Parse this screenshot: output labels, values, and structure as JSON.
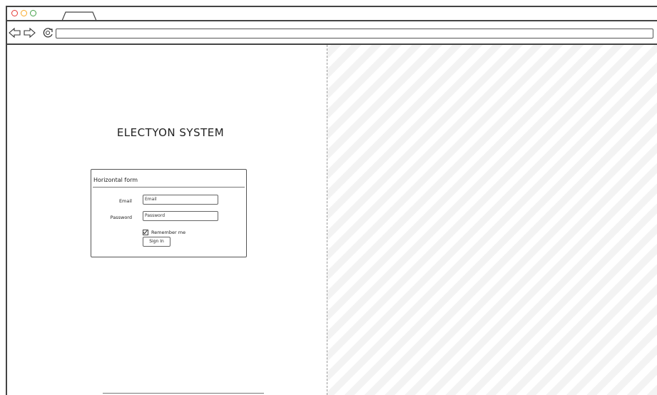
{
  "window": {
    "controls": {
      "close_color": "#e53935",
      "minimize_color": "#f9a825",
      "maximize_color": "#43a047"
    }
  },
  "nav": {
    "back_icon": "arrow-left-icon",
    "forward_icon": "arrow-right-icon",
    "reload_icon": "reload-icon",
    "url": ""
  },
  "app": {
    "title": "ELECTYON SYSTEM"
  },
  "form": {
    "heading": "Horizontal form",
    "email_label": "Email",
    "email_placeholder": "Email",
    "password_label": "Password",
    "password_placeholder": "Password",
    "remember_label": "Remember me",
    "remember_checked": true,
    "submit_label": "Sign In"
  }
}
